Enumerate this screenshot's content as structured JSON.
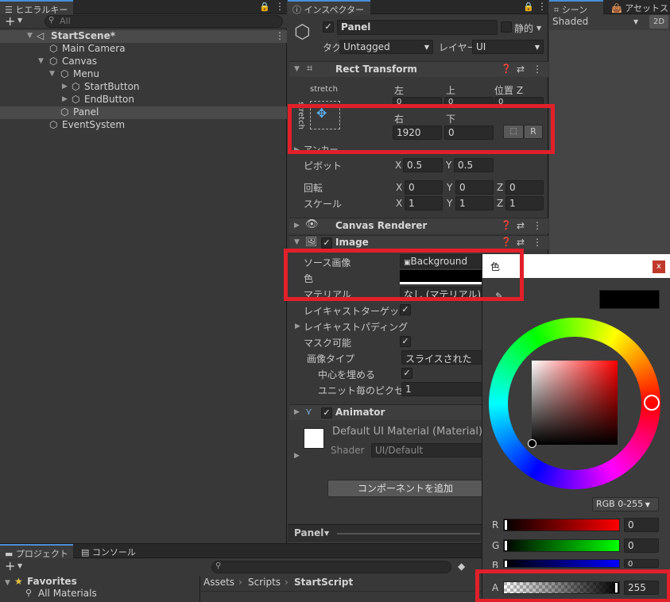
{
  "hierarchy": {
    "tab": "ヒエラルキー",
    "search_placeholder": "All",
    "scene": "StartScene*",
    "items": [
      "Main Camera",
      "Canvas",
      "Menu",
      "StartButton",
      "EndButton",
      "Panel",
      "EventSystem"
    ]
  },
  "inspector": {
    "tab": "インスペクター",
    "object_name": "Panel",
    "static_label": "静的",
    "tag_label": "タグ",
    "tag_value": "Untagged",
    "layer_label": "レイヤー",
    "layer_value": "UI",
    "rect_transform": {
      "title": "Rect Transform",
      "anchor_preset": "stretch",
      "anchor_side": "stretch",
      "left_label": "左",
      "top_label": "上",
      "posz_label": "位置 Z",
      "left_value": "0",
      "top_value": "0",
      "posz_value": "0",
      "right_label": "右",
      "bottom_label": "下",
      "right_value": "1920",
      "bottom_value": "0",
      "r_button": "R",
      "anchor_label": "アンカー",
      "pivot_label": "ピボット",
      "pivot_x": "0.5",
      "pivot_y": "0.5",
      "rotation_label": "回転",
      "rot_x": "0",
      "rot_y": "0",
      "rot_z": "0",
      "scale_label": "スケール",
      "scale_x": "1",
      "scale_y": "1",
      "scale_z": "1",
      "x": "X",
      "y": "Y",
      "z": "Z"
    },
    "canvas_renderer": {
      "title": "Canvas Renderer"
    },
    "image": {
      "title": "Image",
      "source_label": "ソース画像",
      "source_value": "Background",
      "color_label": "色",
      "material_label": "マテリアル",
      "material_value": "なし (マテリアル)",
      "raycast_target_label": "レイキャストターゲット",
      "raycast_padding_label": "レイキャストパディング",
      "maskable_label": "マスク可能",
      "image_type_label": "画像タイプ",
      "image_type_value": "スライスされた",
      "fill_center_label": "中心を埋める",
      "ppu_label": "ユニット毎のピクセル乗",
      "ppu_value": "1"
    },
    "animator": {
      "title": "Animator"
    },
    "material": {
      "name": "Default UI Material (Material)",
      "shader_label": "Shader",
      "shader_value": "UI/Default"
    },
    "add_component": "コンポーネントを追加",
    "footer": "Panel"
  },
  "scene_view": {
    "tab": "シーン",
    "tab2": "アセットストア",
    "shading": "Shaded",
    "mode_2d": "2D"
  },
  "color_picker": {
    "title": "色",
    "close": "x",
    "mode": "RGB 0-255",
    "r_label": "R",
    "r_value": "0",
    "g_label": "G",
    "g_value": "0",
    "b_label": "B",
    "b_value": "0",
    "a_label": "A",
    "a_value": "255",
    "a_fraction": 1.0,
    "current_color": "#000000"
  },
  "project": {
    "tab": "プロジェクト",
    "tab2": "コンソール",
    "favorites": "Favorites",
    "all_materials": "All Materials",
    "breadcrumb": [
      "Assets",
      "Scripts",
      "StartScript"
    ]
  },
  "colors": {
    "highlight": "#e1202a",
    "accent": "#4a8fd6"
  }
}
